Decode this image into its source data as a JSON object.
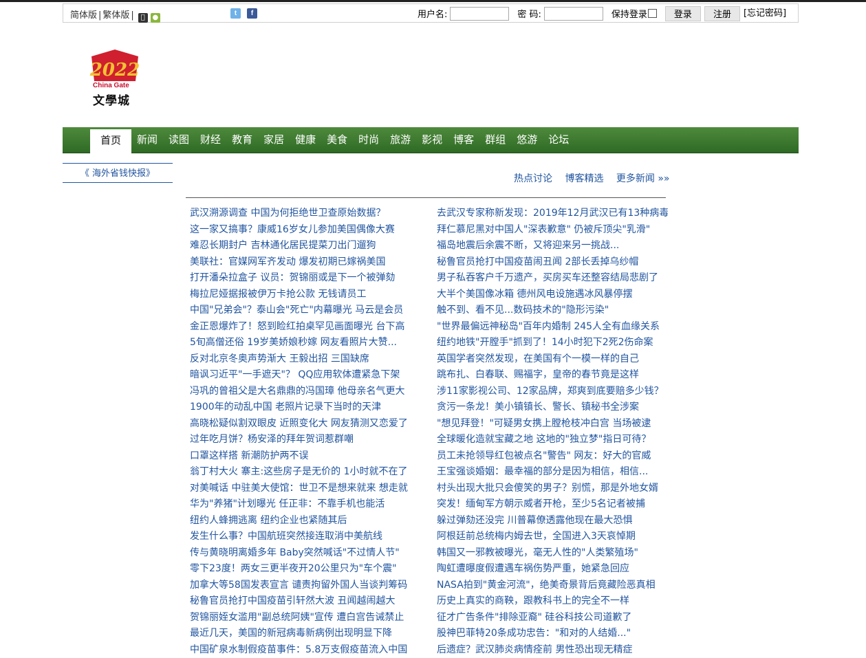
{
  "topbar": {
    "simplified": "简体版",
    "traditional": "繁体版",
    "username_label": "用户名:",
    "password_label": "密 码:",
    "remember_label": "保持登录",
    "login_button": "登录",
    "register_button": "注册",
    "forgot_link": "[忘记密码]"
  },
  "logo": {
    "year": "2022",
    "english": "China Gate",
    "chinese": "文學城"
  },
  "nav": {
    "items": [
      "首页",
      "新闻",
      "读图",
      "财经",
      "教育",
      "家居",
      "健康",
      "美食",
      "时尚",
      "旅游",
      "影视",
      "博客",
      "群组",
      "悠游",
      "论坛"
    ],
    "active": "首页"
  },
  "sidebar": {
    "link": "《 海外省钱快报》"
  },
  "tabs": {
    "hot": "热点讨论",
    "blog": "博客精选",
    "more": "更多新闻 »»"
  },
  "news_left": [
    "武汉溯源调查 中国为何拒绝世卫查原始数据？",
    "这一家又搞事？康威16岁女儿参加美国偶像大赛",
    "难忍长期封户 吉林通化居民提菜刀出门遛狗",
    "美联社：官媒网军齐发动 爆发初期已嫁祸美国",
    "打开潘朵拉盒子 议员：贺锦丽或是下一个被弹劾",
    "梅拉尼娅据报被伊万卡抢公款 无钱请员工",
    "中国\"兄弟会\"？泰山会\"死亡\"内幕曝光 马云是会员",
    "金正恩爆炸了！怒到睑红拍桌罕见画面曝光 台下高",
    "5旬高僧还俗 19岁美娇娘秒嫁 网友看照片大赞...",
    "反对北京冬奥声势渐大 王毅出招 三国缺席",
    "暗讽习近平\"一手遮天\"？ QQ应用软体遭紧急下架",
    "冯巩的曾祖父是大名鼎鼎的冯国璋 他母亲名气更大",
    "1900年的动乱中国 老照片记录下当时的天津",
    "高晓松疑似割双眼皮 近照变化大 网友猜测又恋爱了",
    "过年吃月饼？杨安泽的拜年贺词惹群嘲",
    "口罩这样搭 新潮防护两不误",
    "翁丁村大火 寨主:这些房子是无价的 1小时就不在了",
    "对美喊话 中驻美大使馆：世卫不是想来就来 想走就",
    "华为\"养猪\"计划曝光 任正非：不靠手机也能活",
    "纽约人蜂拥逃离 纽约企业也紧随其后",
    "发生什么事？中国航班突然接连取消中美航线",
    "传与黄晓明离婚多年 Baby突然喊话\"不过情人节\"",
    "零下23度！两女三更半夜开20公里只为\"车个震\"",
    "加拿大等58国发表宣言 谴责拘留外国人当谈判筹码",
    "秘鲁官员抢打中国疫苗引轩然大波 丑闻越闹越大",
    "贺锦丽姪女滥用\"副总统阿姨\"宣传 遭白宫告诫禁止",
    "最近几天，美国的新冠病毒新病例出现明显下降",
    "中国矿泉水制假疫苗事件：5.8万支假疫苗流入中国"
  ],
  "news_right": [
    "去武汉专家称新发现：2019年12月武汉已有13种病毒",
    "拜仁慕尼黑对中国人\"深表歉意\" 仍被斥顶尖\"乳滑\"",
    "福岛地震后余震不断，又将迎来另一挑战...",
    "秘鲁官员抢打中国疫苗闹丑闻 2部长丢掉乌纱帽",
    "男子私吞客户千万遗产，买房买车还整容结局悲剧了",
    "大半个美国像冰箱 德州风电设施遇冰风暴停摆",
    "触不到、看不见...数码技术的\"隐形污染\"",
    "\"世界最偏远神秘岛\"百年内婚制 245人全有血缘关系",
    "纽约地铁\"开膛手\"抓到了！14小时犯下2死2伤命案",
    "英国学者突然发现，在美国有个一模一样的自己",
    "跳布扎、白春联、赐福字，皇帝的春节竟是这样",
    "涉11家影视公司、12家品牌，郑爽到底要赔多少钱？",
    "贪污一条龙！美小镇镇长、警长、镇秘书全涉案",
    "\"想见拜登！\"可疑男女携上膛枪枝冲白宫 当场被逮",
    "全球暖化造就宝藏之地 这地的\"独立梦\"指日可待？",
    "员工未抢领导红包被点名\"警告\" 网友：好大的官威",
    "王宝强谈婚姻：最幸福的部分是因为相信，相信...",
    "村头出现大批只会傻笑的男子？别慌，那是外地女婿",
    "突发！缅甸军方朝示威者开枪，至少5名记者被捕",
    "躲过弹劾还没完 川普幕僚透露他现在最大恐惧",
    "阿根廷前总统梅内姆去世，全国进入3天哀悼期",
    "韩国又一邪教被曝光，毫无人性的\"人类繁殖场\"",
    "陶虹遭曝度假遭遇车祸伤势严重，她紧急回应",
    "NASA拍到\"黄金河流\"，绝美奇景背后竟藏险恶真相",
    "历史上真实的商鞅，跟教科书上的完全不一样",
    "征才广告条件\"排除亚裔\" 硅谷科技公司道歉了",
    "股神巴菲特20条成功忠告：\"和对的人结婚...\"",
    "后遗症？武汉肺炎病情痊前 男性恐出现无精症"
  ]
}
